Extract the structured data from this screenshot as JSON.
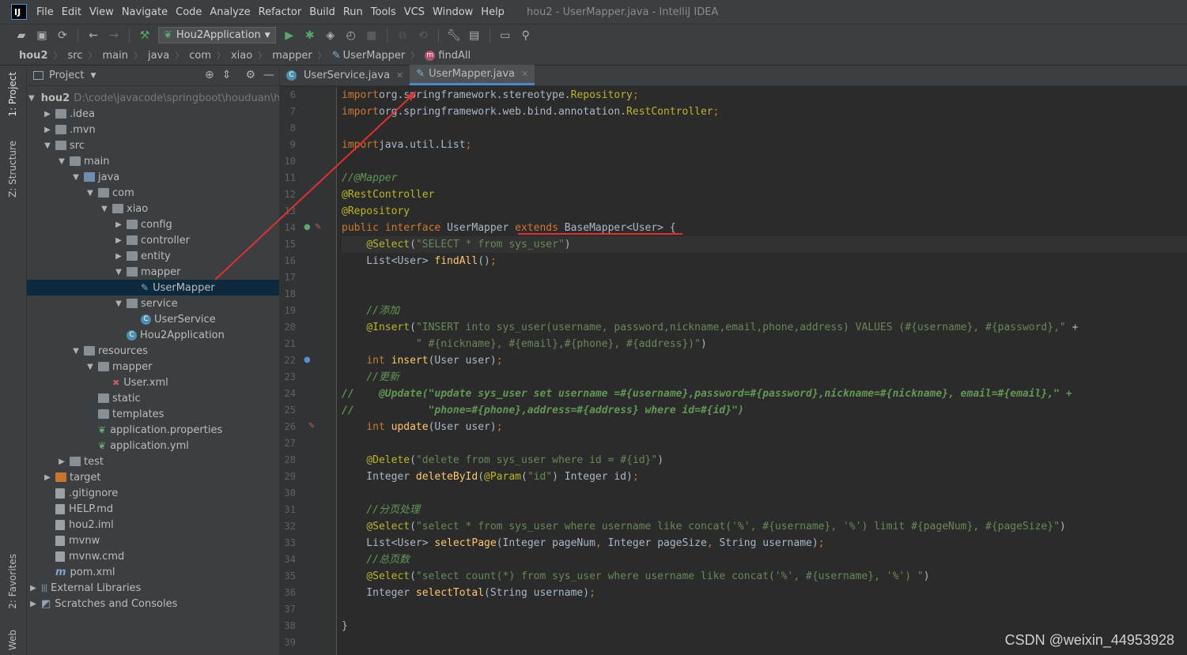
{
  "menubar": {
    "items": [
      "File",
      "Edit",
      "View",
      "Navigate",
      "Code",
      "Analyze",
      "Refactor",
      "Build",
      "Run",
      "Tools",
      "VCS",
      "Window",
      "Help"
    ],
    "window_title": "hou2 - UserMapper.java - IntelliJ IDEA"
  },
  "toolbar": {
    "run_config": "Hou2Application"
  },
  "breadcrumbs": [
    "hou2",
    "src",
    "main",
    "java",
    "com",
    "xiao",
    "mapper",
    "UserMapper",
    "findAll"
  ],
  "side_tabs": {
    "project": "1: Project",
    "structure": "Z: Structure",
    "favorites": "2: Favorites",
    "web": "Web"
  },
  "project_panel": {
    "title": "Project",
    "tree": [
      {
        "label": "hou2",
        "extra": "D:\\code\\javacode\\springboot\\houduan\\h",
        "depth": 0,
        "arrow": "open",
        "icon": "folder",
        "bold": true
      },
      {
        "label": ".idea",
        "depth": 1,
        "arrow": "closed",
        "icon": "folder"
      },
      {
        "label": ".mvn",
        "depth": 1,
        "arrow": "closed",
        "icon": "folder"
      },
      {
        "label": "src",
        "depth": 1,
        "arrow": "open",
        "icon": "folder"
      },
      {
        "label": "main",
        "depth": 2,
        "arrow": "open",
        "icon": "folder"
      },
      {
        "label": "java",
        "depth": 3,
        "arrow": "open",
        "icon": "folder-blue"
      },
      {
        "label": "com",
        "depth": 4,
        "arrow": "open",
        "icon": "folder"
      },
      {
        "label": "xiao",
        "depth": 5,
        "arrow": "open",
        "icon": "folder"
      },
      {
        "label": "config",
        "depth": 6,
        "arrow": "closed",
        "icon": "folder"
      },
      {
        "label": "controller",
        "depth": 6,
        "arrow": "closed",
        "icon": "folder"
      },
      {
        "label": "entity",
        "depth": 6,
        "arrow": "closed",
        "icon": "folder"
      },
      {
        "label": "mapper",
        "depth": 6,
        "arrow": "open",
        "icon": "folder"
      },
      {
        "label": "UserMapper",
        "depth": 7,
        "arrow": "none",
        "icon": "mapper",
        "selected": true
      },
      {
        "label": "service",
        "depth": 6,
        "arrow": "open",
        "icon": "folder"
      },
      {
        "label": "UserService",
        "depth": 7,
        "arrow": "none",
        "icon": "class"
      },
      {
        "label": "Hou2Application",
        "depth": 6,
        "arrow": "none",
        "icon": "class"
      },
      {
        "label": "resources",
        "depth": 3,
        "arrow": "open",
        "icon": "folder"
      },
      {
        "label": "mapper",
        "depth": 4,
        "arrow": "open",
        "icon": "folder"
      },
      {
        "label": "User.xml",
        "depth": 5,
        "arrow": "none",
        "icon": "xml"
      },
      {
        "label": "static",
        "depth": 4,
        "arrow": "none",
        "icon": "folder"
      },
      {
        "label": "templates",
        "depth": 4,
        "arrow": "none",
        "icon": "folder"
      },
      {
        "label": "application.properties",
        "depth": 4,
        "arrow": "none",
        "icon": "props"
      },
      {
        "label": "application.yml",
        "depth": 4,
        "arrow": "none",
        "icon": "props"
      },
      {
        "label": "test",
        "depth": 2,
        "arrow": "closed",
        "icon": "folder"
      },
      {
        "label": "target",
        "depth": 1,
        "arrow": "closed",
        "icon": "folder-orange"
      },
      {
        "label": ".gitignore",
        "depth": 1,
        "arrow": "none",
        "icon": "file"
      },
      {
        "label": "HELP.md",
        "depth": 1,
        "arrow": "none",
        "icon": "file"
      },
      {
        "label": "hou2.iml",
        "depth": 1,
        "arrow": "none",
        "icon": "file"
      },
      {
        "label": "mvnw",
        "depth": 1,
        "arrow": "none",
        "icon": "file"
      },
      {
        "label": "mvnw.cmd",
        "depth": 1,
        "arrow": "none",
        "icon": "file"
      },
      {
        "label": "pom.xml",
        "depth": 1,
        "arrow": "none",
        "icon": "maven"
      },
      {
        "label": "External Libraries",
        "depth": 0,
        "arrow": "closed",
        "icon": "lib"
      },
      {
        "label": "Scratches and Consoles",
        "depth": 0,
        "arrow": "closed",
        "icon": "scratch"
      }
    ]
  },
  "editor": {
    "tabs": [
      {
        "label": "UserService.java",
        "active": false
      },
      {
        "label": "UserMapper.java",
        "active": true
      }
    ],
    "lines": [
      {
        "n": "6",
        "segs": [
          [
            "kw",
            "import"
          ],
          [
            "",
            "org.springframework.stereotype."
          ],
          [
            "an",
            "Repository"
          ],
          [
            "kw",
            ";"
          ]
        ]
      },
      {
        "n": "7",
        "segs": [
          [
            "kw",
            "import"
          ],
          [
            "",
            "org.springframework.web.bind.annotation."
          ],
          [
            "an",
            "RestController"
          ],
          [
            "kw",
            ";"
          ]
        ]
      },
      {
        "n": "8",
        "segs": []
      },
      {
        "n": "9",
        "segs": [
          [
            "kw",
            "import"
          ],
          [
            "",
            "java.util.List"
          ],
          [
            "kw",
            ";"
          ]
        ]
      },
      {
        "n": "10",
        "segs": []
      },
      {
        "n": "11",
        "segs": [
          [
            "cm",
            "//@Mapper"
          ]
        ]
      },
      {
        "n": "12",
        "segs": [
          [
            "an",
            "@RestController"
          ]
        ]
      },
      {
        "n": "13",
        "segs": [
          [
            "an",
            "@Repository"
          ]
        ]
      },
      {
        "n": "14",
        "segs": [
          [
            "kw",
            "public interface "
          ],
          [
            "",
            "UserMapper "
          ],
          [
            "kw",
            "extends "
          ],
          [
            "",
            "BaseMapper<User> {"
          ]
        ]
      },
      {
        "n": "15",
        "segs": [
          [
            "",
            "    "
          ],
          [
            "an",
            "@Select"
          ],
          [
            "",
            "("
          ],
          [
            "st",
            "\"SELECT * from sys_user\""
          ],
          [
            "",
            ")"
          ]
        ],
        "current": true
      },
      {
        "n": "16",
        "segs": [
          [
            "",
            "    List<User> "
          ],
          [
            "fn",
            "findAll"
          ],
          [
            "",
            "()"
          ],
          [
            "kw",
            ";"
          ]
        ]
      },
      {
        "n": "17",
        "segs": []
      },
      {
        "n": "18",
        "segs": []
      },
      {
        "n": "19",
        "segs": [
          [
            "",
            "    "
          ],
          [
            "cm",
            "//添加"
          ]
        ]
      },
      {
        "n": "20",
        "segs": [
          [
            "",
            "    "
          ],
          [
            "an",
            "@Insert"
          ],
          [
            "",
            "("
          ],
          [
            "st",
            "\"INSERT into sys_user(username, password,nickname,email,phone,address) VALUES (#{username}, #{password},\""
          ],
          [
            "",
            " +"
          ]
        ]
      },
      {
        "n": "21",
        "segs": [
          [
            "",
            "            "
          ],
          [
            "st",
            "\" #{nickname}, #{email},#{phone}, #{address})\""
          ],
          [
            "",
            ")"
          ]
        ]
      },
      {
        "n": "22",
        "segs": [
          [
            "",
            "    "
          ],
          [
            "kw",
            "int "
          ],
          [
            "fn",
            "insert"
          ],
          [
            "",
            "(User user)"
          ],
          [
            "kw",
            ";"
          ]
        ]
      },
      {
        "n": "23",
        "segs": [
          [
            "",
            "    "
          ],
          [
            "cm",
            "//更新"
          ]
        ]
      },
      {
        "n": "24",
        "segs": [
          [
            "cmg",
            "//    @Update(\"update sys_user set username =#{username},password=#{password},nickname=#{nickname}, email=#{email},\" +"
          ]
        ]
      },
      {
        "n": "25",
        "segs": [
          [
            "cmg",
            "//            \"phone=#{phone},address=#{address} where id=#{id}\")"
          ]
        ]
      },
      {
        "n": "26",
        "segs": [
          [
            "",
            "    "
          ],
          [
            "kw",
            "int "
          ],
          [
            "fn",
            "update"
          ],
          [
            "",
            "(User user)"
          ],
          [
            "kw",
            ";"
          ]
        ]
      },
      {
        "n": "27",
        "segs": []
      },
      {
        "n": "28",
        "segs": [
          [
            "",
            "    "
          ],
          [
            "an",
            "@Delete"
          ],
          [
            "",
            "("
          ],
          [
            "st",
            "\"delete from sys_user where id = #{id}\""
          ],
          [
            "",
            ")"
          ]
        ]
      },
      {
        "n": "29",
        "segs": [
          [
            "",
            "    Integer "
          ],
          [
            "fn",
            "deleteById"
          ],
          [
            "",
            "("
          ],
          [
            "an",
            "@Param"
          ],
          [
            "",
            "("
          ],
          [
            "st",
            "\"id\""
          ],
          [
            "",
            ") Integer id)"
          ],
          [
            "kw",
            ";"
          ]
        ]
      },
      {
        "n": "30",
        "segs": []
      },
      {
        "n": "31",
        "segs": [
          [
            "",
            "    "
          ],
          [
            "cm",
            "//分页处理"
          ]
        ]
      },
      {
        "n": "32",
        "segs": [
          [
            "",
            "    "
          ],
          [
            "an",
            "@Select"
          ],
          [
            "",
            "("
          ],
          [
            "st",
            "\"select * from sys_user where username like concat('%', #{username}, '%') limit #{pageNum}, #{pageSize}\""
          ],
          [
            "",
            ")"
          ]
        ]
      },
      {
        "n": "33",
        "segs": [
          [
            "",
            "    List<User> "
          ],
          [
            "fn",
            "selectPage"
          ],
          [
            "",
            "(Integer pageNum"
          ],
          [
            "kw",
            ", "
          ],
          [
            "",
            "Integer pageSize"
          ],
          [
            "kw",
            ", "
          ],
          [
            "",
            "String username)"
          ],
          [
            "kw",
            ";"
          ]
        ]
      },
      {
        "n": "34",
        "segs": [
          [
            "",
            "    "
          ],
          [
            "cm",
            "//总页数"
          ]
        ]
      },
      {
        "n": "35",
        "segs": [
          [
            "",
            "    "
          ],
          [
            "an",
            "@Select"
          ],
          [
            "",
            "("
          ],
          [
            "st",
            "\"select count(*) from sys_user where username like concat('%', #{username}, '%') \""
          ],
          [
            "",
            ")"
          ]
        ]
      },
      {
        "n": "36",
        "segs": [
          [
            "",
            "    Integer "
          ],
          [
            "fn",
            "selectTotal"
          ],
          [
            "",
            "(String username)"
          ],
          [
            "kw",
            ";"
          ]
        ]
      },
      {
        "n": "37",
        "segs": []
      },
      {
        "n": "38",
        "segs": [
          [
            "",
            "}"
          ]
        ]
      },
      {
        "n": "39",
        "segs": []
      }
    ]
  },
  "watermark": "CSDN @weixin_44953928",
  "colors": {
    "annotation": "#e03030",
    "keyword": "#cc7832",
    "annotation_code": "#bbb529",
    "string": "#6a8759",
    "comment": "#629755"
  }
}
